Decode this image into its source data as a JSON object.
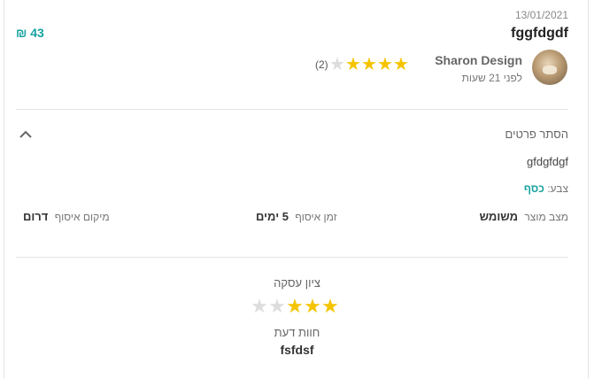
{
  "review": {
    "date": "13/01/2021",
    "title": "fggfdgdf",
    "price": "43 ₪"
  },
  "seller": {
    "name": "Sharon Design",
    "time_ago": "לפני 21 שעות",
    "rating": 4,
    "rating_max": 5,
    "rating_count": "(2)",
    "avatar_icon": "avatar-photo"
  },
  "details_toggle": {
    "label": "הסתר פרטים",
    "icon": "chevron-up-icon"
  },
  "details": {
    "description": "gfdgfdgf",
    "color_label": "צבע:",
    "color_value": "כסף",
    "condition_label": "מצב מוצר",
    "condition_value": "משומש",
    "pickup_time_label": "זמן איסוף",
    "pickup_time_value": "5 ימים",
    "pickup_location_label": "מיקום איסוף",
    "pickup_location_value": "דרום"
  },
  "deal": {
    "label": "ציון עסקה",
    "rating": 3,
    "rating_max": 5,
    "opinion_label": "חוות דעת",
    "opinion_value": "fsfdsf"
  },
  "colors": {
    "accent": "#17a2a0",
    "star_on": "#f4c400",
    "star_off": "#dddddd"
  }
}
